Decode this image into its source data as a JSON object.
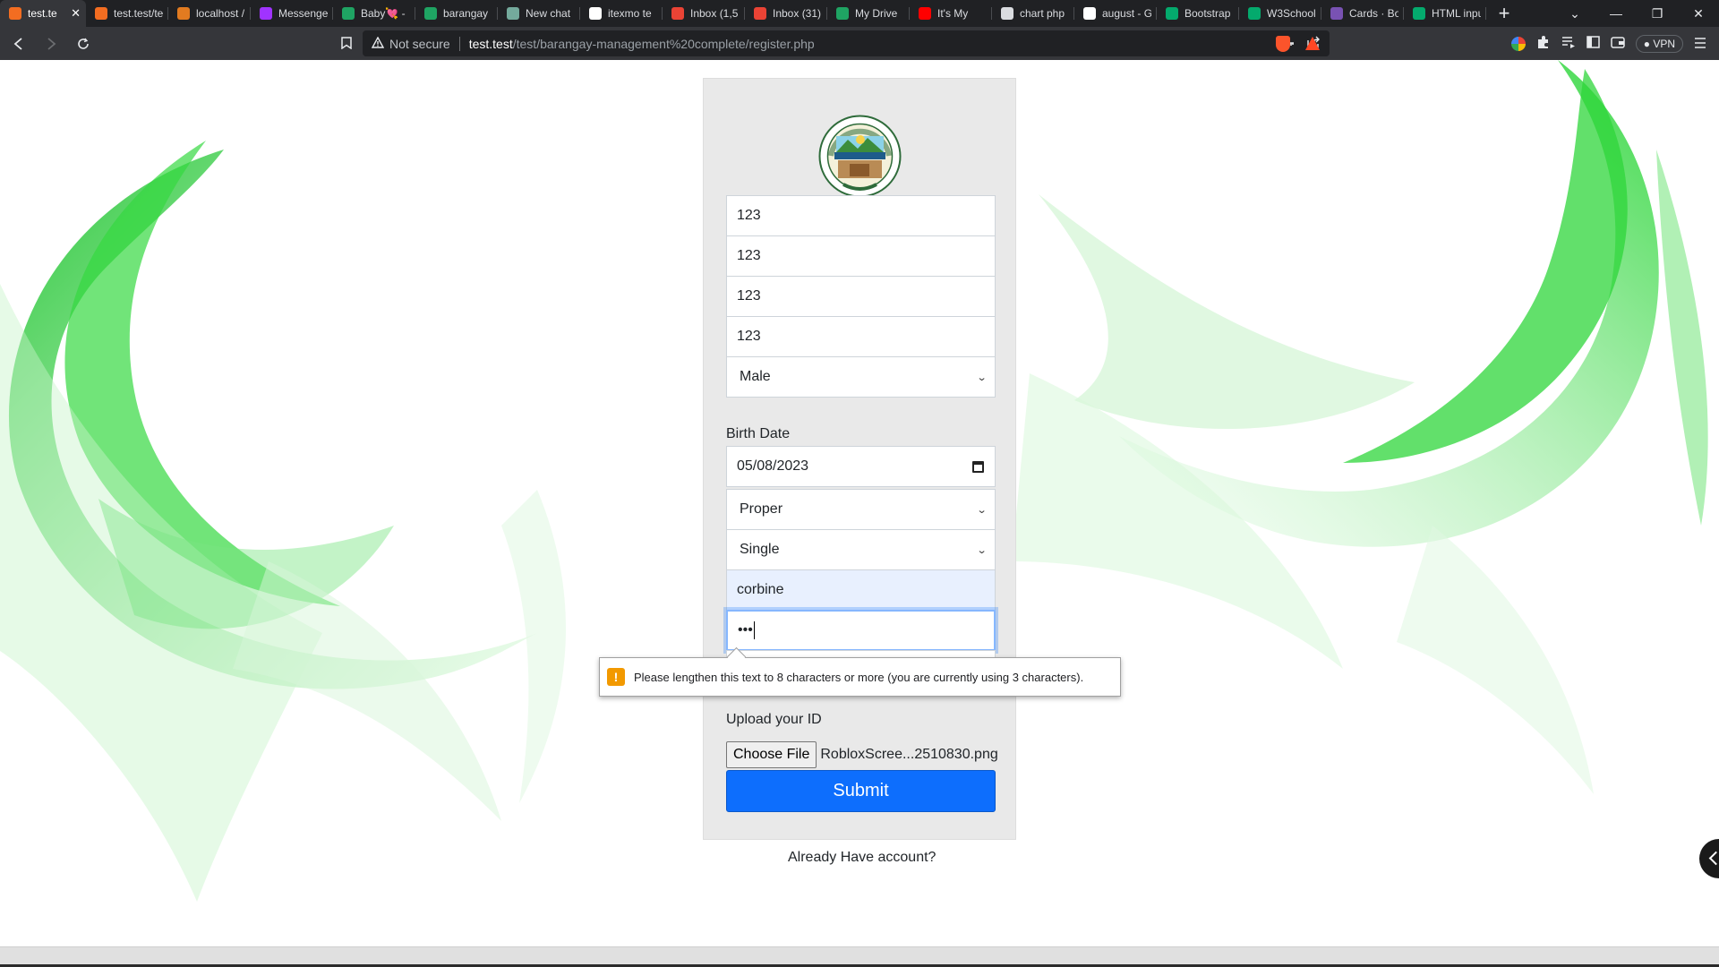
{
  "browser": {
    "tabs": [
      {
        "label": "test.te",
        "favicon_color": "#f36d21",
        "favicon_glyph": "</>",
        "active": true
      },
      {
        "label": "test.test/te",
        "favicon_color": "#f36d21",
        "favicon_glyph": "</>",
        "active": false
      },
      {
        "label": "localhost /",
        "favicon_color": "#e27b20",
        "favicon_glyph": "pma",
        "active": false
      },
      {
        "label": "Messenge",
        "favicon_color": "#a033ff",
        "favicon_glyph": "m",
        "active": false
      },
      {
        "label": "Baby💘 -",
        "favicon_color": "#1fa463",
        "favicon_glyph": "drive",
        "active": false
      },
      {
        "label": "barangay",
        "favicon_color": "#1fa463",
        "favicon_glyph": "drive",
        "active": false
      },
      {
        "label": "New chat",
        "favicon_color": "#74aa9c",
        "favicon_glyph": "ai",
        "active": false
      },
      {
        "label": "itexmo te",
        "favicon_color": "#ffffff",
        "favicon_glyph": "G",
        "active": false
      },
      {
        "label": "Inbox (1,5",
        "favicon_color": "#ea4335",
        "favicon_glyph": "M",
        "active": false
      },
      {
        "label": "Inbox (31)",
        "favicon_color": "#ea4335",
        "favicon_glyph": "M",
        "active": false
      },
      {
        "label": "My Drive",
        "favicon_color": "#1fa463",
        "favicon_glyph": "drive",
        "active": false
      },
      {
        "label": "It's My",
        "favicon_color": "#ff0000",
        "favicon_glyph": "▶",
        "active": false
      },
      {
        "label": "chart php",
        "favicon_color": "#dadce0",
        "favicon_glyph": "globe",
        "active": false
      },
      {
        "label": "august - G",
        "favicon_color": "#ffffff",
        "favicon_glyph": "G",
        "active": false
      },
      {
        "label": "Bootstrap",
        "favicon_color": "#04aa6d",
        "favicon_glyph": "W",
        "active": false
      },
      {
        "label": "W3School",
        "favicon_color": "#04aa6d",
        "favicon_glyph": "W",
        "active": false
      },
      {
        "label": "Cards · Bo",
        "favicon_color": "#7952b3",
        "favicon_glyph": "B",
        "active": false
      },
      {
        "label": "HTML inpu",
        "favicon_color": "#04aa6d",
        "favicon_glyph": "W",
        "active": false
      }
    ],
    "new_tab": "+",
    "window_controls": {
      "dropdown": "⌄",
      "minimize": "—",
      "restore": "❐",
      "close": "✕"
    },
    "address": {
      "security_label": "Not secure",
      "url_host": "test.test",
      "url_path": "/test/barangay-management%20complete/register.php"
    },
    "vpn_label": "VPN"
  },
  "form": {
    "seal_text_top": "OFFICIAL SEAL",
    "seal_year": "1946",
    "fields": [
      {
        "value": "123"
      },
      {
        "value": "123"
      },
      {
        "value": "123"
      },
      {
        "value": "123"
      }
    ],
    "gender_select": "Male",
    "birth_date_label": "Birth Date",
    "birth_date_value": "05/08/2023",
    "residence_select": "Proper",
    "civil_status_select": "Single",
    "username_value": "corbine",
    "password_value": "•••",
    "upload_label": "Upload your ID",
    "choose_file_label": "Choose File",
    "file_name": "RobloxScree...2510830.png",
    "submit_label": "Submit",
    "account_link": "Already Have account?"
  },
  "validation_tooltip": {
    "icon": "!",
    "message": "Please lengthen this text to 8 characters or more (you are currently using 3 characters)."
  },
  "colors": {
    "primary": "#0d6efd",
    "tooltip_warning": "#f29900",
    "background_art": "#3ddc4a"
  }
}
